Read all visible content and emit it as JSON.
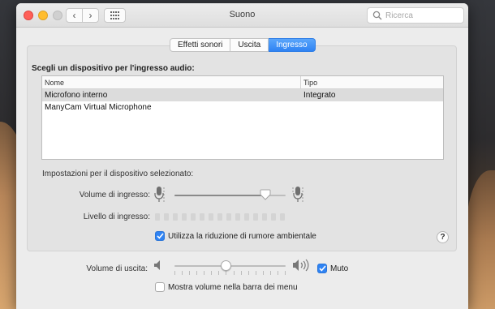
{
  "window": {
    "title": "Suono",
    "search_placeholder": "Ricerca"
  },
  "tabs": [
    {
      "label": "Effetti sonori",
      "active": false
    },
    {
      "label": "Uscita",
      "active": false
    },
    {
      "label": "Ingresso",
      "active": true
    }
  ],
  "input": {
    "section_title": "Scegli un dispositivo per l'ingresso audio:",
    "columns": {
      "name": "Nome",
      "type": "Tipo"
    },
    "devices": [
      {
        "name": "Microfono interno",
        "type": "Integrato",
        "selected": true
      },
      {
        "name": "ManyCam Virtual Microphone",
        "type": "",
        "selected": false
      }
    ],
    "settings_label": "Impostazioni per il dispositivo selezionato:",
    "volume_label": "Volume di ingresso:",
    "volume_level": 0.82,
    "level_label": "Livello di ingresso:",
    "level_active_segments": 0,
    "noise_reduction_label": "Utilizza la riduzione di rumore ambientale",
    "noise_reduction_checked": true
  },
  "output": {
    "volume_label": "Volume di uscita:",
    "volume_level": 0.46,
    "mute_label": "Muto",
    "mute_checked": true,
    "menu_bar_label": "Mostra volume nella barra dei menu",
    "menu_bar_checked": false
  },
  "help": "?",
  "colors": {
    "accent": "#2f83f3",
    "selected_row": "#dcdcdc",
    "close": "#fe5f57",
    "minimize": "#ffbd2e"
  },
  "icons": [
    "close-icon",
    "minimize-icon",
    "zoom-icon",
    "chevron-left-icon",
    "chevron-right-icon",
    "grid-icon",
    "search-icon",
    "microphone-icon",
    "speaker-icon",
    "checkmark-icon",
    "help-icon"
  ]
}
